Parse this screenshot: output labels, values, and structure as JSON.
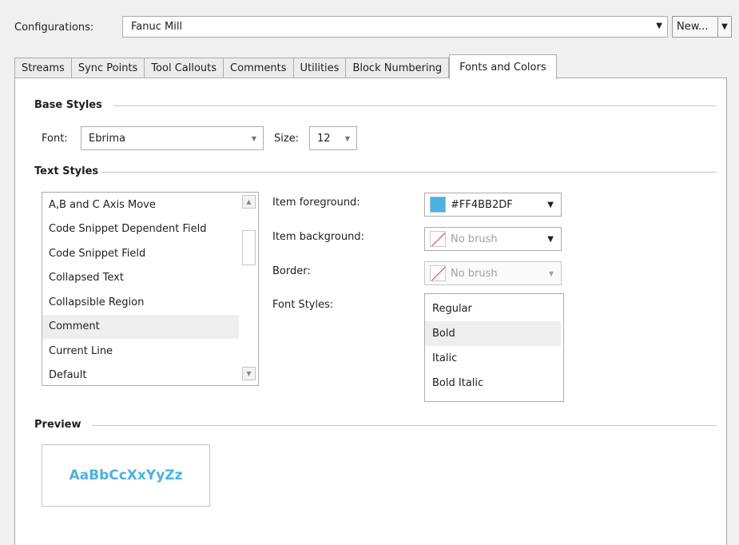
{
  "config": {
    "label": "Configurations:",
    "value": "Fanuc Mill",
    "new_label": "New...",
    "dropdown_arrow": "▼"
  },
  "tabs": [
    {
      "label": "Streams"
    },
    {
      "label": "Sync Points"
    },
    {
      "label": "Tool Callouts"
    },
    {
      "label": "Comments"
    },
    {
      "label": "Utilities"
    },
    {
      "label": "Block Numbering"
    },
    {
      "label": "Fonts and Colors",
      "active": true
    }
  ],
  "base_styles": {
    "title": "Base Styles",
    "font_label": "Font:",
    "font_value": "Ebrima",
    "size_label": "Size:",
    "size_value": "12"
  },
  "text_styles": {
    "title": "Text Styles",
    "items": [
      "A,B and C Axis Move",
      "Code Snippet Dependent Field",
      "Code Snippet Field",
      "Collapsed Text",
      "Collapsible Region",
      "Comment",
      "Current Line",
      "Default"
    ],
    "selected_index": 5,
    "item_foreground_label": "Item foreground:",
    "item_foreground_value": "#FF4BB2DF",
    "item_foreground_color": "#4bb2df",
    "item_background_label": "Item background:",
    "item_background_value": "No brush",
    "border_label": "Border:",
    "border_value": "No brush",
    "font_styles_label": "Font Styles:",
    "font_styles": [
      "Regular",
      "Bold",
      "Italic",
      "Bold Italic"
    ],
    "font_styles_selected_index": 1
  },
  "preview": {
    "title": "Preview",
    "sample_text": "AaBbCcXxYyZz",
    "color": "#4bb2df"
  }
}
